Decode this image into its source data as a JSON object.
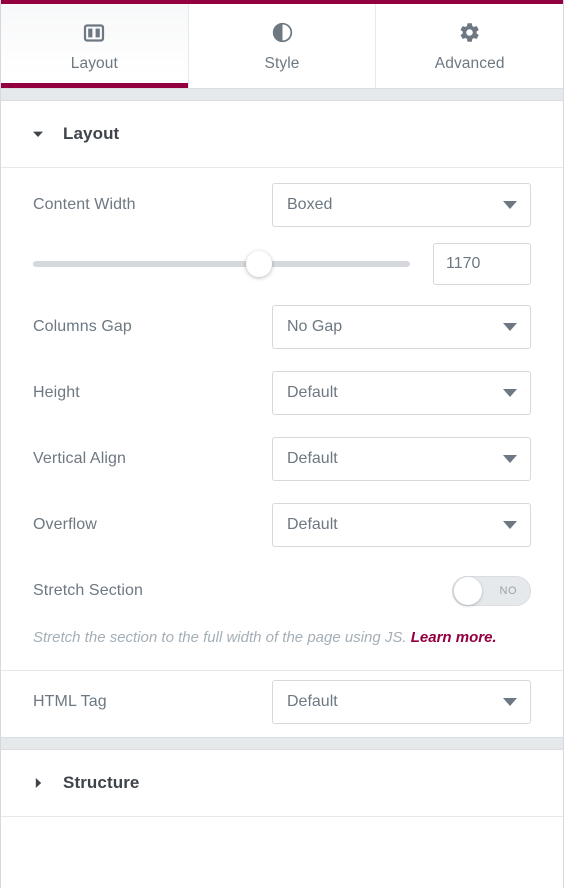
{
  "tabs": [
    {
      "label": "Layout",
      "icon": "columns-icon",
      "active": true
    },
    {
      "label": "Style",
      "icon": "contrast-circle-icon",
      "active": false
    },
    {
      "label": "Advanced",
      "icon": "gear-icon",
      "active": false
    }
  ],
  "sections": {
    "layout": {
      "title": "Layout",
      "expanded": true,
      "caret_icon": "chevron-down-icon"
    },
    "structure": {
      "title": "Structure",
      "expanded": false,
      "caret_icon": "chevron-right-icon"
    }
  },
  "controls": {
    "content_width": {
      "label": "Content Width",
      "value": "Boxed",
      "arrow_icon": "chevron-down-icon"
    },
    "width_slider": {
      "value": "1170",
      "placeholder": "",
      "percent": 60,
      "min": 0,
      "max": 1500
    },
    "columns_gap": {
      "label": "Columns Gap",
      "value": "No Gap",
      "arrow_icon": "chevron-down-icon"
    },
    "height": {
      "label": "Height",
      "value": "Default",
      "arrow_icon": "chevron-down-icon"
    },
    "vertical_align": {
      "label": "Vertical Align",
      "value": "Default",
      "arrow_icon": "chevron-down-icon"
    },
    "overflow": {
      "label": "Overflow",
      "value": "Default",
      "arrow_icon": "chevron-down-icon"
    },
    "stretch_section": {
      "label": "Stretch Section",
      "toggle_state": "NO",
      "description": "Stretch the section to the full width of the page using JS.",
      "link_text": "Learn more."
    },
    "html_tag": {
      "label": "HTML Tag",
      "value": "Default",
      "arrow_icon": "chevron-down-icon"
    }
  },
  "colors": {
    "accent": "#93003f",
    "text": "#6d7882",
    "heading": "#3f444b",
    "border": "#d5d8dc",
    "muted": "#a4afb7",
    "panel_gap": "#e6e9ec"
  }
}
